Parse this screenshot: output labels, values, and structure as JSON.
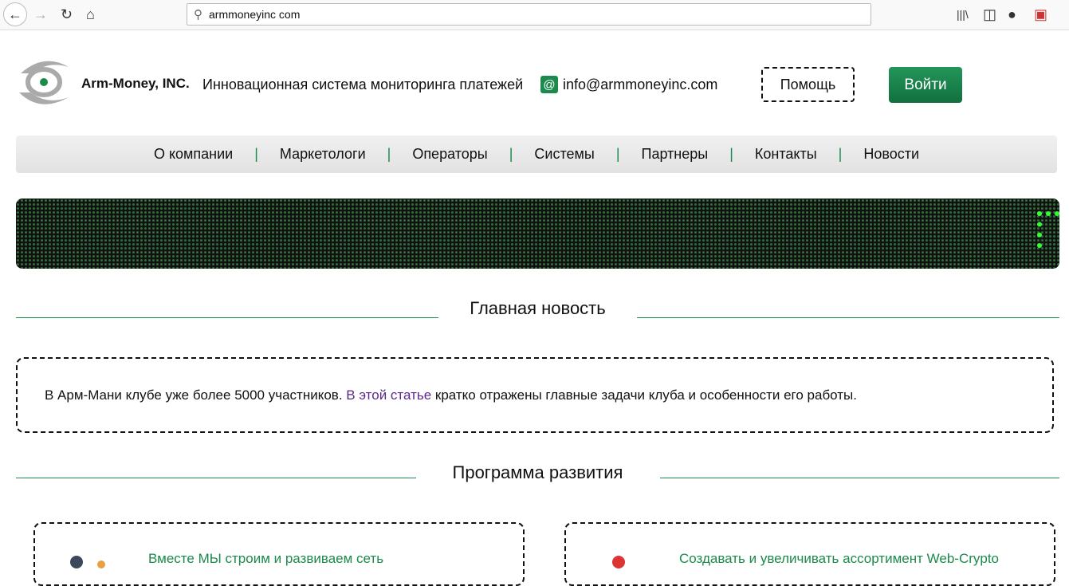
{
  "browser": {
    "url": "armmoneyinc com"
  },
  "header": {
    "brand": "Arm-Money, INC.",
    "tagline": "Инновационная система мониторинга платежей",
    "email": "info@armmoneyinc.com",
    "help_label": "Помощь",
    "login_label": "Войти"
  },
  "nav": {
    "items": [
      "О компании",
      "Маркетологи",
      "Операторы",
      "Системы",
      "Партнеры",
      "Контакты",
      "Новости"
    ]
  },
  "main_news": {
    "title": "Главная новость",
    "text_before": "В Арм-Мани клубе уже более 5000 участников. ",
    "link": "В этой статье",
    "text_after": " кратко отражены главные задачи клуба и особенности его работы."
  },
  "program": {
    "title": "Программа развития",
    "cards": [
      "Вместе МЫ строим и развиваем сеть",
      "Создавать и увеличивать ассортимент Web-Crypto"
    ]
  },
  "colors": {
    "accent": "#1b8a4c",
    "link": "#5a2a8a"
  }
}
